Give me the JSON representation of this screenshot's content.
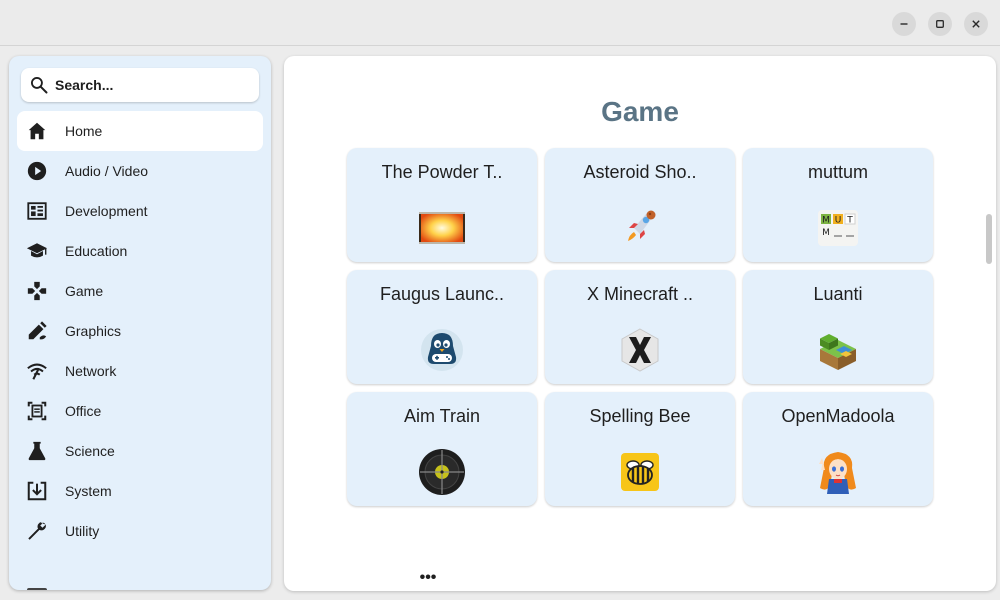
{
  "window": {
    "controls": [
      {
        "name": "minimize",
        "icon": "minimize-icon"
      },
      {
        "name": "maximize",
        "icon": "maximize-icon"
      },
      {
        "name": "close",
        "icon": "close-icon"
      }
    ]
  },
  "search": {
    "placeholder": "Search...",
    "icon": "search-icon"
  },
  "sidebar": {
    "items": [
      {
        "label": "Home",
        "icon": "home-icon",
        "active": true
      },
      {
        "label": "Audio / Video",
        "icon": "play-circle-icon",
        "active": false
      },
      {
        "label": "Development",
        "icon": "development-icon",
        "active": false
      },
      {
        "label": "Education",
        "icon": "graduation-cap-icon",
        "active": false
      },
      {
        "label": "Game",
        "icon": "gamepad-icon",
        "active": false
      },
      {
        "label": "Graphics",
        "icon": "paint-brush-icon",
        "active": false
      },
      {
        "label": "Network",
        "icon": "wifi-icon",
        "active": false
      },
      {
        "label": "Office",
        "icon": "document-scan-icon",
        "active": false
      },
      {
        "label": "Science",
        "icon": "flask-icon",
        "active": false
      },
      {
        "label": "System",
        "icon": "system-download-icon",
        "active": false
      },
      {
        "label": "Utility",
        "icon": "wrench-icon",
        "active": false
      }
    ]
  },
  "main": {
    "heading": "Game",
    "more_label": "•••",
    "apps": [
      {
        "title": "The Powder T..",
        "icon": "powder-toy-icon"
      },
      {
        "title": "Asteroid Sho..",
        "icon": "rocket-icon"
      },
      {
        "title": "muttum",
        "icon": "muttum-letters-icon"
      },
      {
        "title": "Faugus Launc..",
        "icon": "faugus-penguin-icon"
      },
      {
        "title": "X Minecraft ..",
        "icon": "x-minecraft-icon"
      },
      {
        "title": "Luanti",
        "icon": "luanti-block-icon"
      },
      {
        "title": "Aim Train",
        "icon": "crosshair-icon"
      },
      {
        "title": "Spelling Bee",
        "icon": "bee-icon"
      },
      {
        "title": "OpenMadoola",
        "icon": "madoola-character-icon"
      }
    ]
  },
  "colors": {
    "sidebar_bg": "#e4f0fb",
    "card_bg": "#e4f0fb",
    "heading": "#5a7485",
    "titlebar": "#ebebeb"
  }
}
